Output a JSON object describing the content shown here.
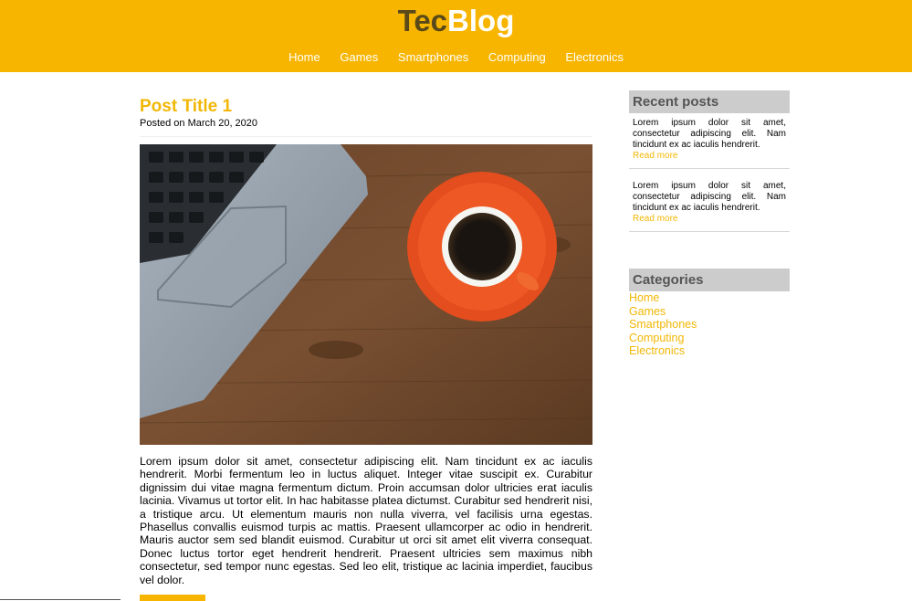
{
  "header": {
    "logo_tec": "Tec",
    "logo_blog": "Blog",
    "nav": [
      "Home",
      "Games",
      "Smartphones",
      "Computing",
      "Electronics"
    ]
  },
  "post": {
    "title": "Post Title 1",
    "posted": "Posted on March 20, 2020",
    "image_icon": "laptop-and-coffee-photo",
    "body": "Lorem ipsum dolor sit amet, consectetur adipiscing elit. Nam tincidunt ex ac iaculis hendrerit. Morbi fermentum leo in luctus aliquet. Integer vitae suscipit ex. Curabitur dignissim dui vitae magna fermentum dictum. Proin accumsan dolor ultricies erat iaculis lacinia. Vivamus ut tortor elit. In hac habitasse platea dictumst. Curabitur sed hendrerit nisi, a tristique arcu. Ut elementum mauris non nulla viverra, vel facilisis urna egestas. Phasellus convallis euismod turpis ac mattis. Praesent ullamcorper ac odio in hendrerit. Mauris auctor sem sed blandit euismod. Curabitur ut orci sit amet elit viverra consequat. Donec luctus tortor eget hendrerit hendrerit. Praesent ultricies sem maximus nibh consectetur, sed tempor nunc egestas. Sed leo elit, tristique ac lacinia imperdiet, faucibus vel dolor."
  },
  "sidebar": {
    "recent_heading": "Recent posts",
    "recent": [
      {
        "text": "Lorem ipsum dolor sit amet, consectetur adipiscing elit. Nam tincidunt ex ac iaculis hendrerit.",
        "link": "Read more"
      },
      {
        "text": "Lorem ipsum dolor sit amet, consectetur adipiscing elit. Nam tincidunt ex ac iaculis hendrerit.",
        "link": "Read more"
      }
    ],
    "categories_heading": "Categories",
    "categories": [
      "Home",
      "Games",
      "Smartphones",
      "Computing",
      "Electronics"
    ]
  },
  "colors": {
    "accent": "#f7b500",
    "title_dark": "#5a4a1a",
    "sidebar_heading_bg": "#cccccc"
  }
}
